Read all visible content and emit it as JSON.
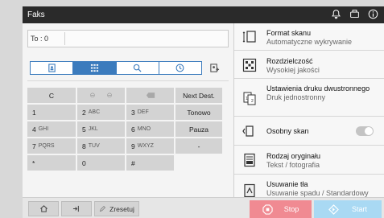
{
  "titlebar": {
    "title": "Faks",
    "icons": [
      "bell-icon",
      "device-icon",
      "info-icon"
    ]
  },
  "destination": {
    "label": "To : 0",
    "value": ""
  },
  "address_tabs": [
    {
      "icon": "address-book-icon",
      "active": false
    },
    {
      "icon": "keypad-icon",
      "active": true
    },
    {
      "icon": "search-icon",
      "active": false
    },
    {
      "icon": "history-icon",
      "active": false
    }
  ],
  "keypad": {
    "row0": {
      "c": "C",
      "next_dest": "Next Dest."
    },
    "row1": {
      "k1": "1",
      "k2": "2",
      "k2s": "ABC",
      "k3": "3",
      "k3s": "DEF",
      "k4": "Tonowo"
    },
    "row2": {
      "k1": "4",
      "k1s": "GHI",
      "k2": "5",
      "k2s": "JKL",
      "k3": "6",
      "k3s": "MNO",
      "k4": "Pauza"
    },
    "row3": {
      "k1": "7",
      "k1s": "PQRS",
      "k2": "8",
      "k2s": "TUV",
      "k3": "9",
      "k3s": "WXYZ",
      "k4": "-"
    },
    "row4": {
      "k1": "*",
      "k2": "0",
      "k3": "#"
    }
  },
  "settings": [
    {
      "title": "Format skanu",
      "value": "Automatyczne wykrywanie",
      "icon": "scan-size-icon"
    },
    {
      "title": "Rozdzielczość",
      "value": "Wysokiej jakości",
      "icon": "resolution-icon"
    },
    {
      "title": "Ustawienia druku dwustronnego",
      "value": "Druk jednostronny",
      "icon": "duplex-icon"
    },
    {
      "title": "Osobny skan",
      "value": "",
      "icon": "separate-scan-icon",
      "toggle": false
    },
    {
      "title": "Rodzaj oryginału",
      "value": "Tekst / fotografia",
      "icon": "original-type-icon"
    },
    {
      "title": "Usuwanie tła",
      "value": "Usuwanie spadu / Standardowy",
      "icon": "background-removal-icon"
    }
  ],
  "bottombar": {
    "reset_label": "Zresetuj",
    "stop_label": "Stop",
    "start_label": "Start"
  },
  "colors": {
    "accent": "#3b7bbd",
    "stop": "#f08a92",
    "start": "#a9d9f3",
    "titlebar": "#2a2a2a"
  }
}
